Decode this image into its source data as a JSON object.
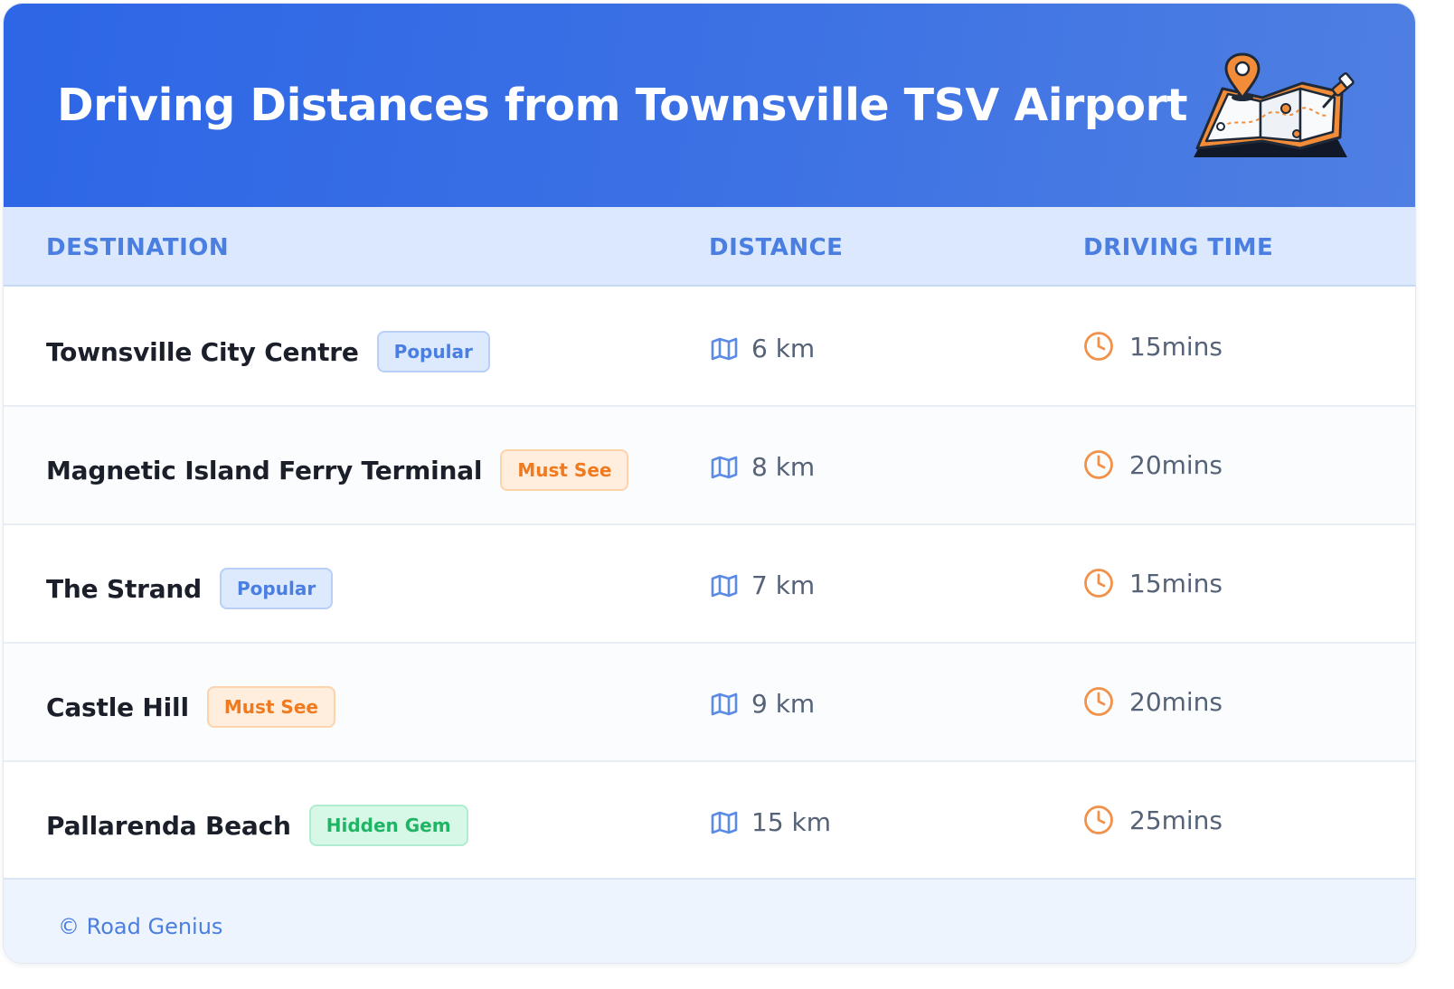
{
  "header": {
    "title": "Driving Distances from Townsville TSV Airport",
    "illustration_icon": "map-with-location-pin-icon",
    "background": "#2d66e6"
  },
  "table": {
    "columns": [
      "DESTINATION",
      "DISTANCE",
      "DRIVING TIME"
    ],
    "rows": [
      {
        "destination": "Townsville City Centre",
        "badge": "Popular",
        "badge_type": "popular",
        "distance": "6 km",
        "time": "15mins"
      },
      {
        "destination": "Magnetic Island Ferry Terminal",
        "badge": "Must See",
        "badge_type": "mustsee",
        "distance": "8 km",
        "time": "20mins"
      },
      {
        "destination": "The Strand",
        "badge": "Popular",
        "badge_type": "popular",
        "distance": "7 km",
        "time": "15mins"
      },
      {
        "destination": "Castle Hill",
        "badge": "Must See",
        "badge_type": "mustsee",
        "distance": "9 km",
        "time": "20mins"
      },
      {
        "destination": "Pallarenda Beach",
        "badge": "Hidden Gem",
        "badge_type": "hiddengem",
        "distance": "15 km",
        "time": "25mins"
      }
    ],
    "distance_icon": "map-icon",
    "time_icon": "clock-icon"
  },
  "footer": {
    "text": "© Road Genius"
  },
  "colors": {
    "header_blue": "#2d66e6",
    "accent_blue": "#4a7ee0",
    "accent_orange": "#ef7a1f",
    "accent_green": "#20b565"
  }
}
